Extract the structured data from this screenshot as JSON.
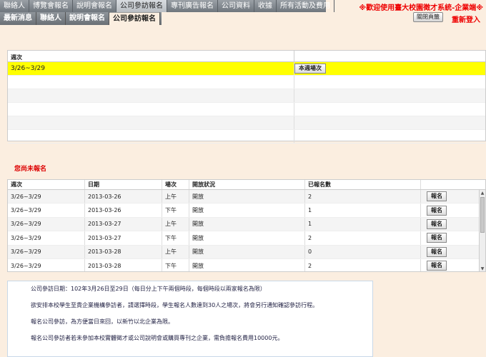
{
  "nav": {
    "primary": [
      "聯絡人",
      "博覽會報名",
      "說明會報名",
      "公司參訪報名",
      "專刊廣告報名",
      "公司資料",
      "收據",
      "所有活動及費用"
    ],
    "secondary": [
      "最新消息",
      "聯絡人",
      "說明會報名",
      "公司參訪報名"
    ],
    "banner": "※歡迎使用臺大校園徵才系統-企業端※",
    "close_label": "關閉頁籤",
    "relogin_label": "重新登入"
  },
  "week_table": {
    "header": "週次",
    "rows": [
      {
        "week": "3/26~3/29",
        "button": "本週場次"
      }
    ]
  },
  "not_registered": "您尚未報名",
  "session_table": {
    "headers": [
      "週次",
      "日期",
      "場次",
      "開放狀況",
      "已報名數",
      ""
    ],
    "rows": [
      {
        "week": "3/26~3/29",
        "date": "2013-03-26",
        "slot": "上午",
        "status": "開放",
        "count": "2",
        "button": "報名"
      },
      {
        "week": "3/26~3/29",
        "date": "2013-03-26",
        "slot": "下午",
        "status": "開放",
        "count": "1",
        "button": "報名"
      },
      {
        "week": "3/26~3/29",
        "date": "2013-03-27",
        "slot": "上午",
        "status": "開放",
        "count": "1",
        "button": "報名"
      },
      {
        "week": "3/26~3/29",
        "date": "2013-03-27",
        "slot": "下午",
        "status": "開放",
        "count": "2",
        "button": "報名"
      },
      {
        "week": "3/26~3/29",
        "date": "2013-03-28",
        "slot": "上午",
        "status": "開放",
        "count": "0",
        "button": "報名"
      },
      {
        "week": "3/26~3/29",
        "date": "2013-03-28",
        "slot": "下午",
        "status": "開放",
        "count": "2",
        "button": "報名"
      }
    ]
  },
  "info": [
    "公司參訪日期：102年3月26日至29日（每日分上下午兩個時段，每個時段以兩家報名為限）",
    "欲安排本校學生至貴企業機構參訪者，請選擇時段，學生報名人數達到30人之場次，將會另行通知確認參訪行程。",
    "報名公司參訪，為方便當日來回，以新竹以北企業為限。",
    "報名公司參訪者若未參加本校實體徵才或公司說明會或購買專刊之企業，需負擔報名費用10000元。"
  ]
}
